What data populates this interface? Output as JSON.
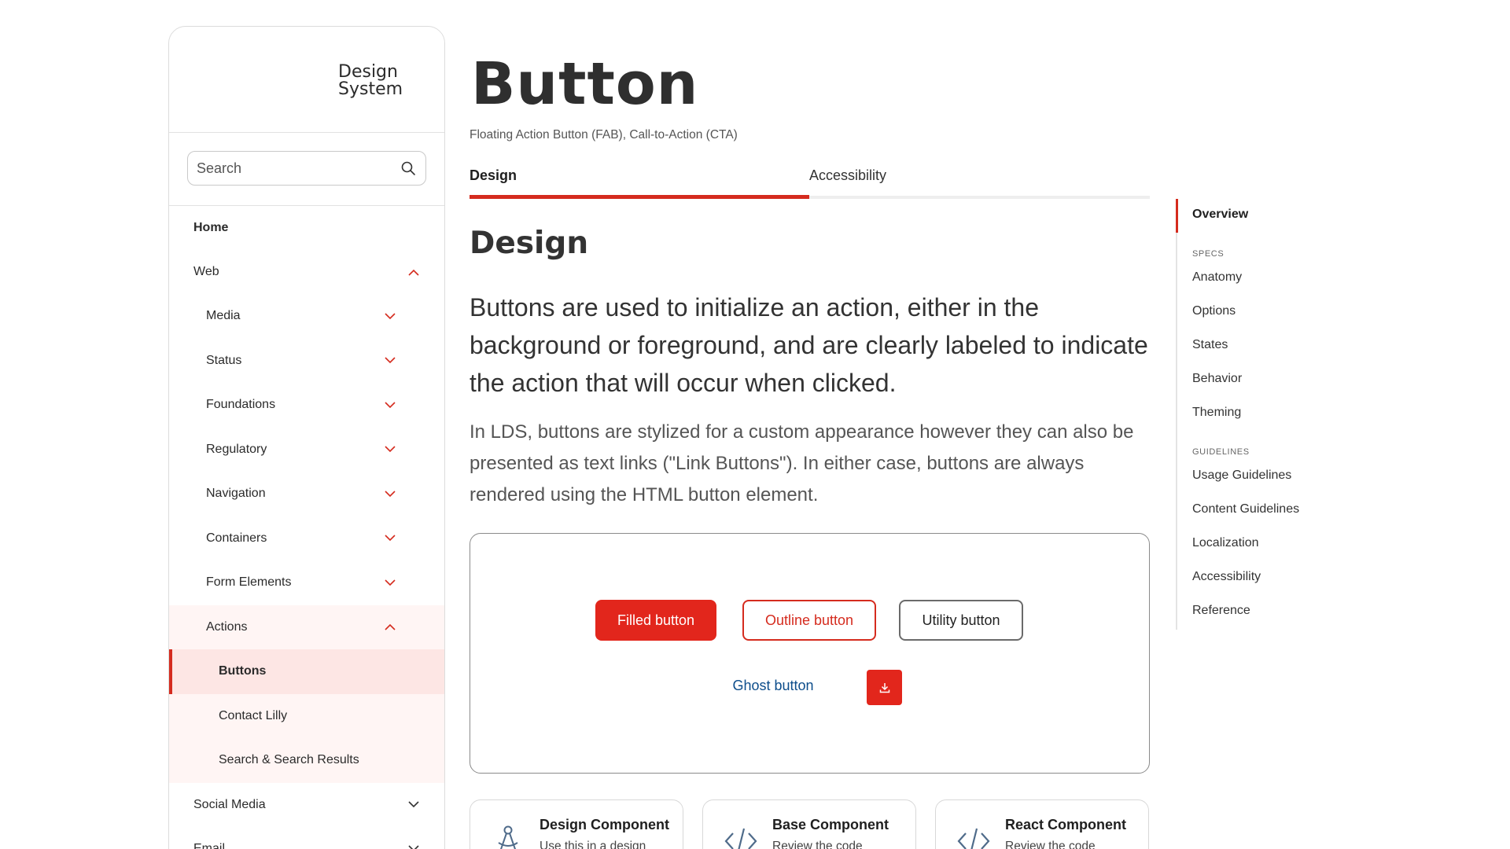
{
  "sidebar": {
    "brand": "Design System",
    "search": {
      "placeholder": "Search",
      "value": ""
    },
    "items": [
      {
        "label": "Home"
      },
      {
        "label": "Web"
      },
      {
        "label": "Media"
      },
      {
        "label": "Status"
      },
      {
        "label": "Foundations"
      },
      {
        "label": "Regulatory"
      },
      {
        "label": "Navigation"
      },
      {
        "label": "Containers"
      },
      {
        "label": "Form Elements"
      },
      {
        "label": "Actions"
      },
      {
        "label": "Buttons"
      },
      {
        "label": "Contact Lilly"
      },
      {
        "label": "Search & Search Results"
      },
      {
        "label": "Social Media"
      },
      {
        "label": "Email"
      }
    ]
  },
  "main": {
    "title": "Button",
    "subtitle": "Floating Action Button (FAB), Call-to-Action (CTA)",
    "tabs": [
      {
        "label": "Design"
      },
      {
        "label": "Accessibility"
      }
    ],
    "section_title": "Design",
    "lead": "Buttons are used to initialize an action, either in the background or foreground, and are clearly labeled to indicate the action that will occur when clicked.",
    "body": "In LDS, buttons are stylized for a custom appearance however they can also be presented as text links (\"Link Buttons\"). In either case, buttons are always rendered using the HTML button element.",
    "demo": {
      "filled": "Filled button",
      "outline": "Outline button",
      "utility": "Utility button",
      "ghost": "Ghost button"
    },
    "cards": [
      {
        "title": "Design Component",
        "desc": "Use this in a design",
        "icon": "compass-icon"
      },
      {
        "title": "Base Component",
        "desc": "Review the code",
        "icon": "code-icon"
      },
      {
        "title": "React Component",
        "desc": "Review the code",
        "icon": "code-icon"
      }
    ]
  },
  "toc": {
    "overview": "Overview",
    "specs_label": "SPECS",
    "specs": [
      "Anatomy",
      "Options",
      "States",
      "Behavior",
      "Theming"
    ],
    "guidelines_label": "GUIDELINES",
    "guidelines": [
      "Usage Guidelines",
      "Content Guidelines",
      "Localization",
      "Accessibility",
      "Reference"
    ]
  },
  "colors": {
    "accent": "#d52b1e",
    "ghost": "#0d4d8b",
    "active_bg": "#fde6e4",
    "tint_bg": "#fff5f4"
  }
}
